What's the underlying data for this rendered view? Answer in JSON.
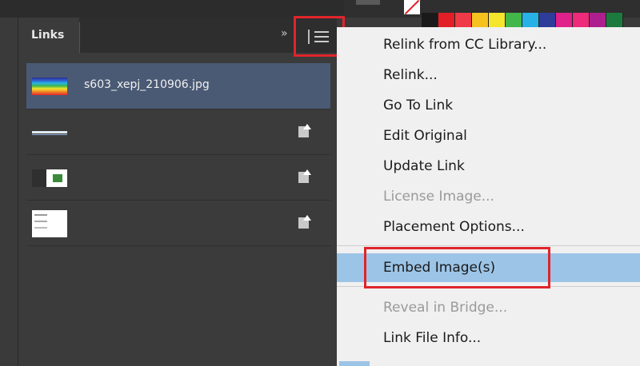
{
  "panel": {
    "tab_label": "Links",
    "collapse_glyph": "»",
    "menu_icon": "panel-menu-icon"
  },
  "links": [
    {
      "name": "s603_xepj_210906.jpg",
      "thumb": "rainbow",
      "selected": true,
      "status_icon": null
    },
    {
      "name": "",
      "thumb": "line",
      "selected": false,
      "status_icon": "modified-link-icon"
    },
    {
      "name": "",
      "thumb": "dark",
      "selected": false,
      "status_icon": "modified-link-icon"
    },
    {
      "name": "",
      "thumb": "doc",
      "selected": false,
      "status_icon": "modified-link-icon"
    }
  ],
  "menu": {
    "items": [
      {
        "label": "Relink from CC Library...",
        "enabled": true
      },
      {
        "label": "Relink...",
        "enabled": true
      },
      {
        "label": "Go To Link",
        "enabled": true
      },
      {
        "label": "Edit Original",
        "enabled": true
      },
      {
        "label": "Update Link",
        "enabled": true
      },
      {
        "label": "License Image...",
        "enabled": false
      },
      {
        "label": "Placement Options...",
        "enabled": true
      },
      {
        "label": "Embed Image(s)",
        "enabled": true,
        "highlighted": true
      },
      {
        "label": "Reveal in Bridge...",
        "enabled": false
      },
      {
        "label": "Link File Info...",
        "enabled": true
      }
    ]
  },
  "colors": {
    "highlight": "#9cc4e6",
    "selection_row": "#4a5a74",
    "annotation_red": "#e0242b"
  },
  "swatches": [
    "#1a1a1a",
    "#e21f26",
    "#ee3b47",
    "#f7c21e",
    "#f5e52d",
    "#43b649",
    "#27b1e6",
    "#2f3d9a",
    "#e0218a",
    "#ee2a7b",
    "#ad1f8e",
    "#1d7a3e"
  ]
}
